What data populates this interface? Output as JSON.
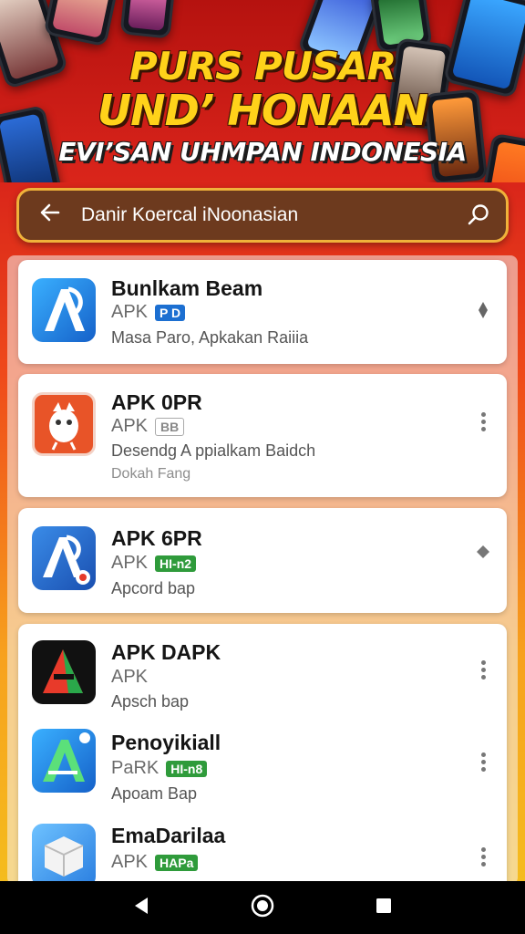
{
  "header": {
    "title_line1": "PURS PUSAR",
    "title_line2": "UND’ HONAAN",
    "subtitle": "EVI’SAN UHMPAN INDONESIA"
  },
  "search": {
    "query": "Danir Koercal iNoonasian",
    "back_icon": "arrow-left-icon",
    "search_icon": "search-icon"
  },
  "apps": [
    {
      "name": "Bunlkam Beam",
      "type": "APK",
      "badge": "P D",
      "badge_color": "#1c6fd1",
      "desc": "Masa Paro, Apkakan Raiiia",
      "extra": "",
      "menu": "diamond"
    },
    {
      "name": "APK 0PR",
      "type": "APK",
      "badge": "BB",
      "badge_color": "#9a9a9a",
      "desc": "Desendg A ppialkam Baidch",
      "extra": "Dokah Fang",
      "menu": "dots"
    },
    {
      "name": "APK 6PR",
      "type": "APK",
      "badge": "HI-n2",
      "badge_color": "#2f9b3b",
      "desc": "Apcord bap",
      "extra": "",
      "menu": "diamond"
    },
    {
      "name": "APK DAPK",
      "type": "APK",
      "badge": "",
      "badge_color": "",
      "desc": "Apsch bap",
      "extra": "",
      "menu": "dots"
    },
    {
      "name": "Penoyikiall",
      "type": "PaRK",
      "badge": "HI-n8",
      "badge_color": "#2f9b3b",
      "desc": "Apoam Bap",
      "extra": "",
      "menu": "dots"
    },
    {
      "name": "EmaDarilaa",
      "type": "APK",
      "badge": "HAPa",
      "badge_color": "#2f9b3b",
      "desc": "",
      "extra": "",
      "menu": "dots"
    }
  ],
  "navbar": {
    "back_icon": "nav-back-icon",
    "home_icon": "nav-home-icon",
    "recents_icon": "nav-recents-icon"
  }
}
